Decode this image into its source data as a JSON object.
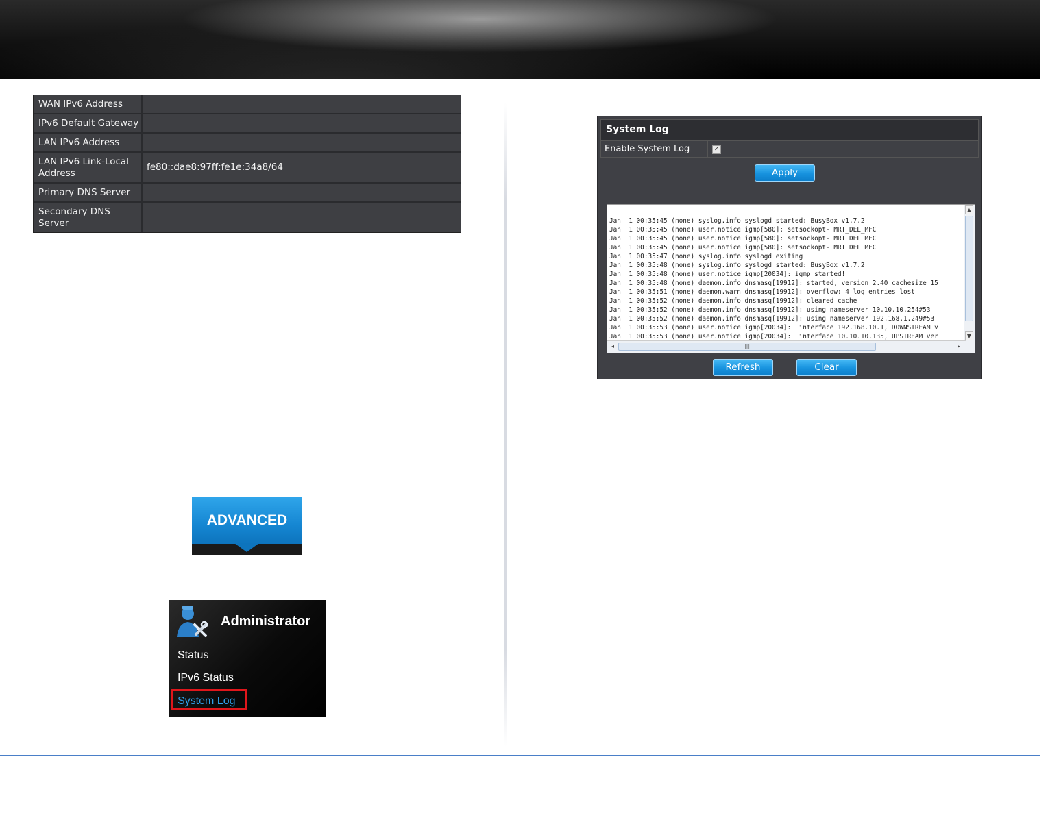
{
  "ipv6_table": [
    {
      "label": "WAN IPv6 Address",
      "value": ""
    },
    {
      "label": "IPv6 Default Gateway",
      "value": ""
    },
    {
      "label": "LAN IPv6 Address",
      "value": ""
    },
    {
      "label": "LAN IPv6 Link-Local Address",
      "value": "fe80::dae8:97ff:fe1e:34a8/64"
    },
    {
      "label": "Primary DNS Server",
      "value": ""
    },
    {
      "label": "Secondary DNS Server",
      "value": ""
    }
  ],
  "advanced_button": {
    "label": "ADVANCED"
  },
  "admin_menu": {
    "title": "Administrator",
    "items": [
      "Status",
      "IPv6 Status",
      "System Log"
    ],
    "active_item": "System Log"
  },
  "system_log": {
    "title": "System Log",
    "enable_label": "Enable System Log",
    "enable_checked": true,
    "apply_label": "Apply",
    "refresh_label": "Refresh",
    "clear_label": "Clear",
    "log_lines": [
      "Jan  1 00:35:45 (none) syslog.info syslogd started: BusyBox v1.7.2",
      "Jan  1 00:35:45 (none) user.notice igmp[580]: setsockopt- MRT_DEL_MFC",
      "Jan  1 00:35:45 (none) user.notice igmp[580]: setsockopt- MRT_DEL_MFC",
      "Jan  1 00:35:45 (none) user.notice igmp[580]: setsockopt- MRT_DEL_MFC",
      "Jan  1 00:35:47 (none) syslog.info syslogd exiting",
      "Jan  1 00:35:48 (none) syslog.info syslogd started: BusyBox v1.7.2",
      "Jan  1 00:35:48 (none) user.notice igmp[20034]: igmp started!",
      "Jan  1 00:35:48 (none) daemon.info dnsmasq[19912]: started, version 2.40 cachesize 15",
      "Jan  1 00:35:51 (none) daemon.warn dnsmasq[19912]: overflow: 4 log entries lost",
      "Jan  1 00:35:52 (none) daemon.info dnsmasq[19912]: cleared cache",
      "Jan  1 00:35:52 (none) daemon.info dnsmasq[19912]: using nameserver 10.10.10.254#53",
      "Jan  1 00:35:52 (none) daemon.info dnsmasq[19912]: using nameserver 192.168.1.249#53",
      "Jan  1 00:35:53 (none) user.notice igmp[20034]:  interface 192.168.10.1, DOWNSTREAM v",
      "Jan  1 00:35:53 (none) user.notice igmp[20034]:  interface 10.10.10.135, UPSTREAM ver"
    ]
  },
  "colors": {
    "panel_bg": "#3f4045",
    "button_blue": "#1792de",
    "active_blue": "#2fa0ea",
    "highlight_red": "#e0161b"
  }
}
